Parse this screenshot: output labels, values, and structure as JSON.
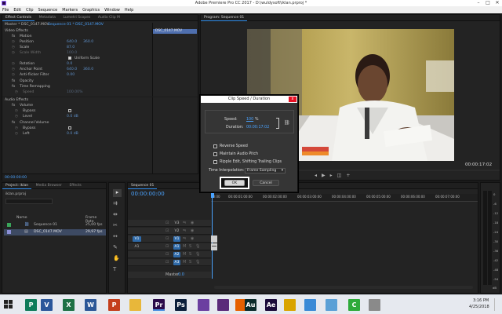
{
  "window": {
    "title": "Adobe Premiere Pro CC 2017 - D:\\wuldysoft\\iklan.prproj *"
  },
  "menu": [
    "File",
    "Edit",
    "Clip",
    "Sequence",
    "Markers",
    "Graphics",
    "Window",
    "Help"
  ],
  "source_panel": {
    "tabs": [
      "Effect Controls",
      "Metadata",
      "Lumetri Scopes",
      "Audio Clip M"
    ],
    "master_label": "Master * DSC_0147.MOV",
    "sequence_label": "Sequence 01 * DSC_0147.MOV",
    "mini_clip_label": "DSC_0147.MOV",
    "video_effects": "Video Effects",
    "motion": "Motion",
    "position": {
      "label": "Position",
      "x": "640.0",
      "y": "360.0"
    },
    "scale": {
      "label": "Scale",
      "value": "87.0"
    },
    "scale_width": {
      "label": "Scale Width",
      "value": "100.0"
    },
    "uniform_scale": "Uniform Scale",
    "rotation": {
      "label": "Rotation",
      "value": "0.0"
    },
    "anchor_point": {
      "label": "Anchor Point",
      "x": "640.0",
      "y": "360.0"
    },
    "anti_flicker": {
      "label": "Anti-flicker Filter",
      "value": "0.00"
    },
    "opacity": "Opacity",
    "time_remapping": "Time Remapping",
    "speed": {
      "label": "Speed",
      "value": "100.00%"
    },
    "audio_effects": "Audio Effects",
    "volume": "Volume",
    "bypass": "Bypass",
    "level": {
      "label": "Level",
      "value": "0.0 dB"
    },
    "channel_volume": "Channel Volume",
    "bypass2": "Bypass",
    "left": {
      "label": "Left",
      "value": "0.0 dB"
    },
    "timecode": "00:00:00:00"
  },
  "program_panel": {
    "tabs": [
      "Program: Sequence 01"
    ],
    "timecode_left": "00:00:00:00",
    "timecode_right": "00:00:17:02"
  },
  "project_panel": {
    "tabs": [
      "Project: iklan",
      "Media Browser",
      "Libraries",
      "Info",
      "Effects"
    ],
    "project_file": "iklan.prproj",
    "columns": {
      "name": "Name",
      "frame_rate": "Frame Rate"
    },
    "items": [
      {
        "name": "Sequence 01",
        "fps": "25,00 fps",
        "color": "#3aa55a"
      },
      {
        "name": "DSC_0147.MOV",
        "fps": "29,97 fps",
        "color": "#8b8fd6"
      }
    ]
  },
  "timeline": {
    "tab": "Sequence 01",
    "timecode": "00:00:00:00",
    "ruler": [
      "00:00",
      "00:00:01:00:00",
      "00:00:02:00:00",
      "00:00:03:00:00",
      "00:00:04:00:00",
      "00:00:05:00:00",
      "00:00:06:00:00",
      "00:00:07:00:00"
    ],
    "tracks": [
      "V3",
      "V2",
      "V1",
      "A1",
      "A2",
      "A3"
    ],
    "source_v1": "V1",
    "source_a1": "A1",
    "master": "Master",
    "master_value": "0.0",
    "meter_scale": [
      "0",
      "-6",
      "-12",
      "-18",
      "-24",
      "-30",
      "-36",
      "-42",
      "-48",
      "-54"
    ],
    "meter_unit": "dB"
  },
  "dialog": {
    "title": "Clip Speed / Duration",
    "close": "x",
    "speed_label": "Speed:",
    "speed_value": "100",
    "speed_unit": "%",
    "duration_label": "Duration:",
    "duration_value": "00:00:17:02",
    "reverse_speed": "Reverse Speed",
    "maintain_pitch": "Maintain Audio Pitch",
    "ripple_edit": "Ripple Edit, Shifting Trailing Clips",
    "time_interp_label": "Time Interpolation:",
    "time_interp_value": "Frame Sampling",
    "ok": "OK",
    "cancel": "Cancel"
  },
  "taskbar": {
    "time": "3:16 PM",
    "date": "4/25/2018",
    "apps": [
      {
        "icon": "publisher-icon",
        "glyph": "P",
        "color": "#0f7b5a"
      },
      {
        "icon": "visio-icon",
        "glyph": "V",
        "color": "#2b579a"
      },
      {
        "icon": "excel-icon",
        "glyph": "X",
        "color": "#1e7145"
      },
      {
        "icon": "word-icon",
        "glyph": "W",
        "color": "#2b5797"
      },
      {
        "icon": "powerpoint-icon",
        "glyph": "P",
        "color": "#c43e1c"
      },
      {
        "icon": "file-explorer-icon",
        "glyph": "",
        "color": "#e8b73a"
      },
      {
        "icon": "premiere-icon",
        "glyph": "Pr",
        "color": "#2a0a4a"
      },
      {
        "icon": "photoshop-icon",
        "glyph": "Ps",
        "color": "#0a1e3a"
      },
      {
        "icon": "visual-studio-icon",
        "glyph": "",
        "color": "#6b3fa0"
      },
      {
        "icon": "media-player-icon",
        "glyph": "",
        "color": "#5a2a7a"
      },
      {
        "icon": "firefox-icon",
        "glyph": "",
        "color": "#e66000"
      },
      {
        "icon": "audition-icon",
        "glyph": "Au",
        "color": "#0a2a2a"
      },
      {
        "icon": "after-effects-icon",
        "glyph": "Ae",
        "color": "#1a0a3a"
      },
      {
        "icon": "chrome-icon",
        "glyph": "",
        "color": "#d9a400"
      },
      {
        "icon": "paint-icon",
        "glyph": "",
        "color": "#3a8ad6"
      },
      {
        "icon": "notepad-icon",
        "glyph": "",
        "color": "#5aa0d6"
      },
      {
        "icon": "camtasia-icon",
        "glyph": "C",
        "color": "#2eaa3a"
      },
      {
        "icon": "drawing-icon",
        "glyph": "",
        "color": "#8a8a8a"
      }
    ]
  }
}
